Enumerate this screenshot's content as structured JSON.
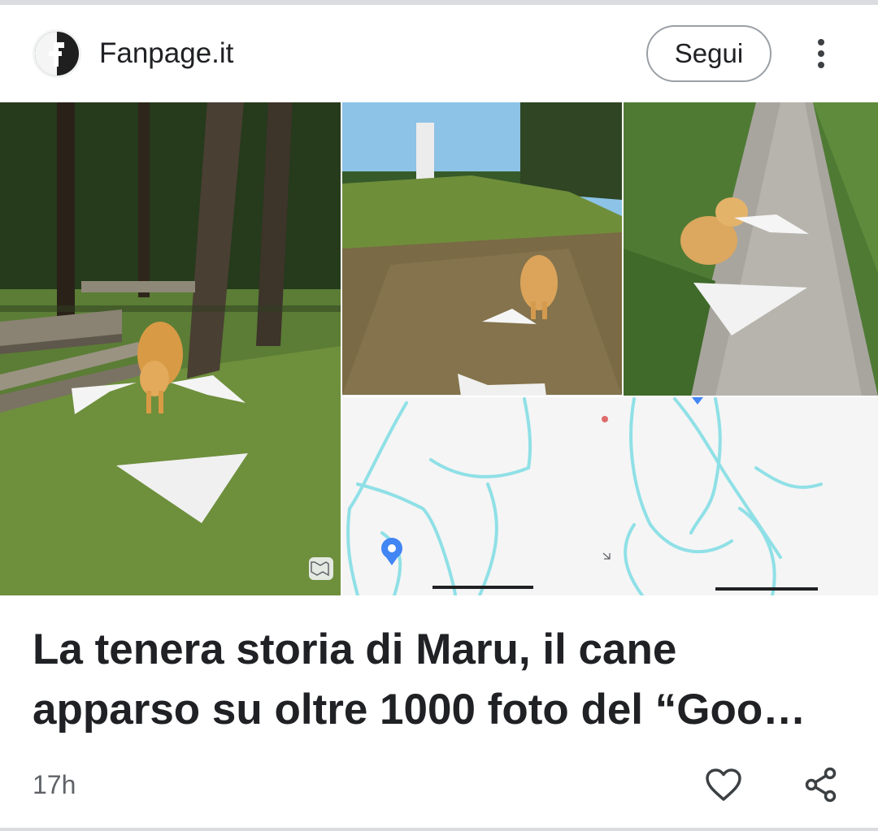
{
  "card": {
    "source": {
      "name": "Fanpage.it",
      "logo_icon": "fanpage-logo-icon"
    },
    "follow_label": "Segui",
    "more_icon": "more-vertical-icon",
    "image": {
      "description_icon": "map-icon"
    },
    "headline": {
      "line1": "La tenera storia di Maru, il cane",
      "line2": "apparso su oltre 1000 foto del “Goo…"
    },
    "age": "17h",
    "like_icon": "heart-outline-icon",
    "share_icon": "share-icon"
  },
  "colors": {
    "text": "#202124",
    "muted": "#5f6368",
    "border": "#9aa0a6",
    "map_water": "#8fe0e6",
    "map_pin": "#4285f4"
  }
}
